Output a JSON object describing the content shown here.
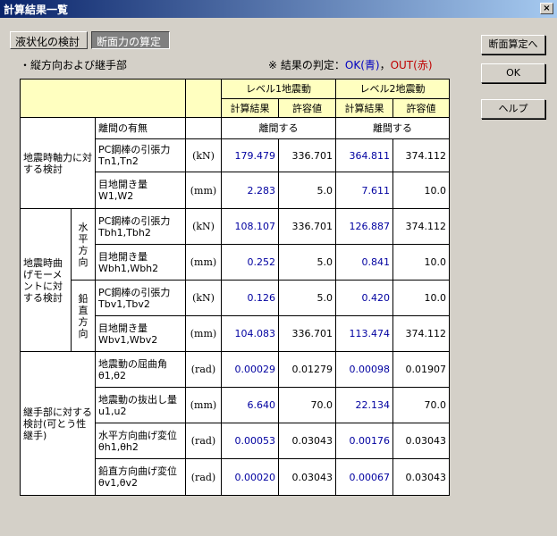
{
  "window": {
    "title": "計算結果一覧",
    "close_label": "×"
  },
  "tabs": [
    {
      "label": "液状化の検討",
      "active": false
    },
    {
      "label": "断面力の算定",
      "active": true
    }
  ],
  "subheading": "・縦方向および継手部",
  "legend": {
    "prefix": "※ 結果の判定：",
    "ok_label": "OK(青)",
    "sep": "，",
    "out_label": "OUT(赤)"
  },
  "buttons": {
    "section_calc": "断面算定へ",
    "ok": "OK",
    "help": "ヘルプ"
  },
  "table": {
    "level1": "レベル1地震動",
    "level2": "レベル2地震動",
    "calc_result": "計算結果",
    "allowable": "許容値",
    "groups": {
      "axial": "地震時軸力に対する検討",
      "moment": "地震時曲げモーメントに対する検討",
      "horizontal": "水平方向",
      "vertical": "鉛直方向",
      "joint": "継手部に対する検討(可とう性継手)"
    },
    "separation": {
      "label": "離間の有無",
      "l1": "離間する",
      "l2": "離間する"
    },
    "rows": [
      {
        "name1": "PC鋼棒の引張力",
        "name2": "Tn1,Tn2",
        "unit": "(kN)",
        "l1_calc": "179.479",
        "l1_allow": "336.701",
        "l2_calc": "364.811",
        "l2_allow": "374.112"
      },
      {
        "name1": "目地開き量",
        "name2": "W1,W2",
        "unit": "(mm)",
        "l1_calc": "2.283",
        "l1_allow": "5.0",
        "l2_calc": "7.611",
        "l2_allow": "10.0"
      },
      {
        "name1": "PC鋼棒の引張力",
        "name2": "Tbh1,Tbh2",
        "unit": "(kN)",
        "l1_calc": "108.107",
        "l1_allow": "336.701",
        "l2_calc": "126.887",
        "l2_allow": "374.112"
      },
      {
        "name1": "目地開き量",
        "name2": "Wbh1,Wbh2",
        "unit": "(mm)",
        "l1_calc": "0.252",
        "l1_allow": "5.0",
        "l2_calc": "0.841",
        "l2_allow": "10.0"
      },
      {
        "name1": "PC鋼棒の引張力",
        "name2": "Tbv1,Tbv2",
        "unit": "(kN)",
        "l1_calc": "0.126",
        "l1_allow": "5.0",
        "l2_calc": "0.420",
        "l2_allow": "10.0"
      },
      {
        "name1": "目地開き量",
        "name2": "Wbv1,Wbv2",
        "unit": "(mm)",
        "l1_calc": "104.083",
        "l1_allow": "336.701",
        "l2_calc": "113.474",
        "l2_allow": "374.112"
      },
      {
        "name1": "地震動の屈曲角",
        "name2": "θ1,θ2",
        "unit": "(rad)",
        "l1_calc": "0.00029",
        "l1_allow": "0.01279",
        "l2_calc": "0.00098",
        "l2_allow": "0.01907"
      },
      {
        "name1": "地震動の抜出し量",
        "name2": "u1,u2",
        "unit": "(mm)",
        "l1_calc": "6.640",
        "l1_allow": "70.0",
        "l2_calc": "22.134",
        "l2_allow": "70.0"
      },
      {
        "name1": "水平方向曲げ変位",
        "name2": "θh1,θh2",
        "unit": "(rad)",
        "l1_calc": "0.00053",
        "l1_allow": "0.03043",
        "l2_calc": "0.00176",
        "l2_allow": "0.03043"
      },
      {
        "name1": "鉛直方向曲げ変位",
        "name2": "θv1,θv2",
        "unit": "(rad)",
        "l1_calc": "0.00020",
        "l1_allow": "0.03043",
        "l2_calc": "0.00067",
        "l2_allow": "0.03043"
      }
    ]
  },
  "colors": {
    "header_bg": "#ffffc0",
    "ok_blue": "#0000c0",
    "out_red": "#c00000",
    "title_blue": "#0a246a"
  }
}
